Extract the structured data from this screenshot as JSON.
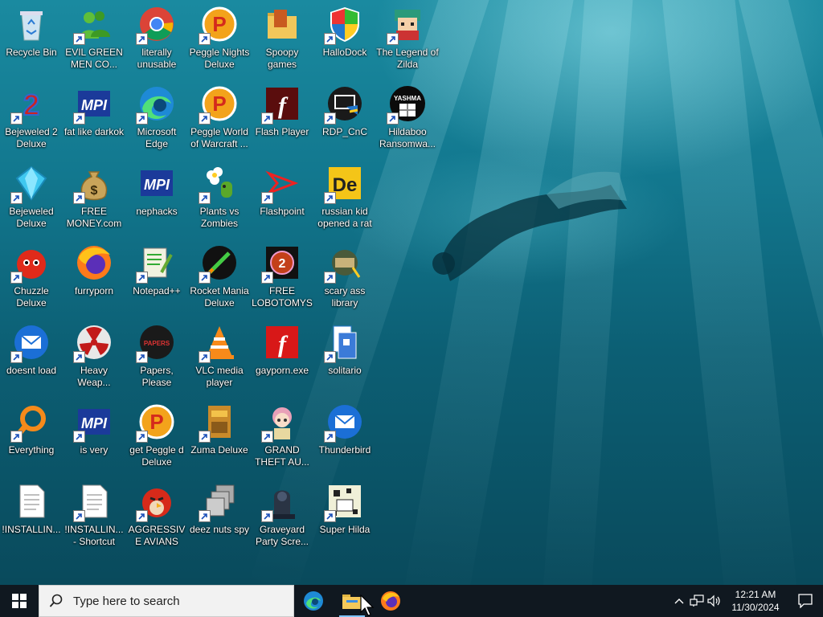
{
  "desktop": {
    "icons": [
      {
        "label": "Recycle Bin",
        "icon": "recycle-bin-icon",
        "shortcut": false
      },
      {
        "label": "EVIL GREEN MEN CO...",
        "icon": "messenger-icon",
        "shortcut": true
      },
      {
        "label": "literally unusable",
        "icon": "chrome-icon",
        "shortcut": true
      },
      {
        "label": "Peggle Nights Deluxe",
        "icon": "peggle-icon",
        "shortcut": true
      },
      {
        "label": "Spoopy games",
        "icon": "folder-icon",
        "shortcut": false
      },
      {
        "label": "HalloDock",
        "icon": "shield-icon",
        "shortcut": true
      },
      {
        "label": "The Legend of Zilda",
        "icon": "game-character-icon",
        "shortcut": true
      },
      {
        "label": "Bejeweled 2 Deluxe",
        "icon": "bejeweled2-icon",
        "shortcut": true
      },
      {
        "label": "fat like darkok",
        "icon": "mpi-icon",
        "shortcut": true
      },
      {
        "label": "Microsoft Edge",
        "icon": "edge-icon",
        "shortcut": true
      },
      {
        "label": "Peggle World of Warcraft ...",
        "icon": "peggle-icon",
        "shortcut": true
      },
      {
        "label": "Flash Player",
        "icon": "flash-dark-icon",
        "shortcut": true
      },
      {
        "label": "RDP_CnC",
        "icon": "rdp-icon",
        "shortcut": true
      },
      {
        "label": "Hildaboo Ransomwa...",
        "icon": "yashma-icon",
        "shortcut": true
      },
      {
        "label": "Bejeweled Deluxe",
        "icon": "gem-icon",
        "shortcut": true
      },
      {
        "label": "FREE MONEY.com",
        "icon": "money-bag-icon",
        "shortcut": true
      },
      {
        "label": "nephacks",
        "icon": "mpi-icon",
        "shortcut": false
      },
      {
        "label": "Plants vs Zombies",
        "icon": "flower-icon",
        "shortcut": true
      },
      {
        "label": "Flashpoint",
        "icon": "flashpoint-icon",
        "shortcut": true
      },
      {
        "label": "russian kid opened a rat",
        "icon": "de-icon",
        "shortcut": true
      },
      {
        "label": "Chuzzle Deluxe",
        "icon": "chuzzle-icon",
        "shortcut": true
      },
      {
        "label": "furryporn",
        "icon": "firefox-icon",
        "shortcut": false
      },
      {
        "label": "Notepad++",
        "icon": "notepad-icon",
        "shortcut": true
      },
      {
        "label": "Rocket Mania Deluxe",
        "icon": "rocket-icon",
        "shortcut": true
      },
      {
        "label": "FREE LOBOTOMYS",
        "icon": "lobotomy-icon",
        "shortcut": true
      },
      {
        "label": "scary ass library",
        "icon": "library-icon",
        "shortcut": true
      },
      {
        "label": "doesnt load",
        "icon": "thunderbird-icon",
        "shortcut": true
      },
      {
        "label": "Heavy Weap...",
        "icon": "radiation-icon",
        "shortcut": true
      },
      {
        "label": "Papers, Please",
        "icon": "papers-please-icon",
        "shortcut": true
      },
      {
        "label": "VLC media player",
        "icon": "vlc-icon",
        "shortcut": true
      },
      {
        "label": "gayporn.exe",
        "icon": "flash-red-icon",
        "shortcut": false
      },
      {
        "label": "solitario",
        "icon": "solitaire-icon",
        "shortcut": true
      },
      {
        "label": "Everything",
        "icon": "magnifier-icon",
        "shortcut": true
      },
      {
        "label": "is very",
        "icon": "mpi-icon",
        "shortcut": true
      },
      {
        "label": "get Peggle d Deluxe",
        "icon": "peggle-icon",
        "shortcut": true
      },
      {
        "label": "Zuma Deluxe",
        "icon": "zuma-icon",
        "shortcut": true
      },
      {
        "label": "GRAND THEFT AU...",
        "icon": "anime-girl-icon",
        "shortcut": true
      },
      {
        "label": "Thunderbird",
        "icon": "thunderbird-icon",
        "shortcut": true
      },
      {
        "label": "!INSTALLIN...",
        "icon": "text-file-icon",
        "shortcut": false
      },
      {
        "label": "!INSTALLIN... - Shortcut",
        "icon": "text-file-icon",
        "shortcut": true
      },
      {
        "label": "AGGRESSIVE AVIANS",
        "icon": "angry-bird-icon",
        "shortcut": true
      },
      {
        "label": "deez nuts spy",
        "icon": "stack-icon",
        "shortcut": true
      },
      {
        "label": "Graveyard Party Scre...",
        "icon": "grave-icon",
        "shortcut": true
      },
      {
        "label": "Super Hilda",
        "icon": "pixel-art-icon",
        "shortcut": true
      }
    ]
  },
  "taskbar": {
    "search_placeholder": "Type here to search",
    "apps": [
      {
        "name": "edge-icon"
      },
      {
        "name": "file-explorer-icon"
      },
      {
        "name": "firefox-icon"
      }
    ],
    "clock_time": "12:21 AM",
    "clock_date": "11/30/2024"
  },
  "colors": {
    "taskbar_bg": "#101820",
    "accent": "#7fc4ff"
  }
}
